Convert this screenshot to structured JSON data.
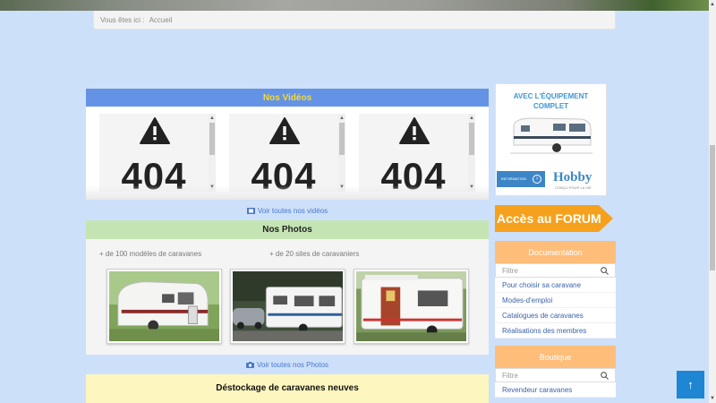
{
  "breadcrumb": {
    "prefix": "Vous êtes ici :",
    "home": "Accueil"
  },
  "videos": {
    "title": "Nos Vidéos",
    "items": [
      {
        "code": "404"
      },
      {
        "code": "404"
      },
      {
        "code": "404"
      }
    ],
    "see_all": "Voir toutes nos vidéos"
  },
  "photos": {
    "title": "Nos Photos",
    "caption_left": "+ de 100 modèles de caravanes",
    "caption_right": "+ de 20 sites de caravaniers",
    "see_all": "Voir toutes nos Photos"
  },
  "destock": {
    "title": "Déstockage de caravanes neuves"
  },
  "ad": {
    "title_line1": "AVEC L'ÉQUIPEMENT",
    "title_line2": "COMPLET",
    "button": "INFORMATION",
    "brand": "Hobby",
    "tagline": "CONÇU POUR LA VIE"
  },
  "forum": {
    "label": "Accès au FORUM"
  },
  "documentation": {
    "title": "Documentation",
    "filter_placeholder": "Filtre",
    "items": [
      "Pour choisir sa caravane",
      "Modes-d'emploi",
      "Catalogues de caravanes",
      "Réalisations des membres"
    ]
  },
  "boutique": {
    "title": "Boutique",
    "filter_placeholder": "Filtre",
    "items": [
      "Revendeur caravanes"
    ]
  },
  "back_to_top": {
    "icon": "↑"
  },
  "colors": {
    "videos_bar": "#6493e5",
    "photos_bar": "#c4e5b3",
    "panel_orange": "#ffbd7a",
    "forum_orange": "#f6a11d"
  }
}
